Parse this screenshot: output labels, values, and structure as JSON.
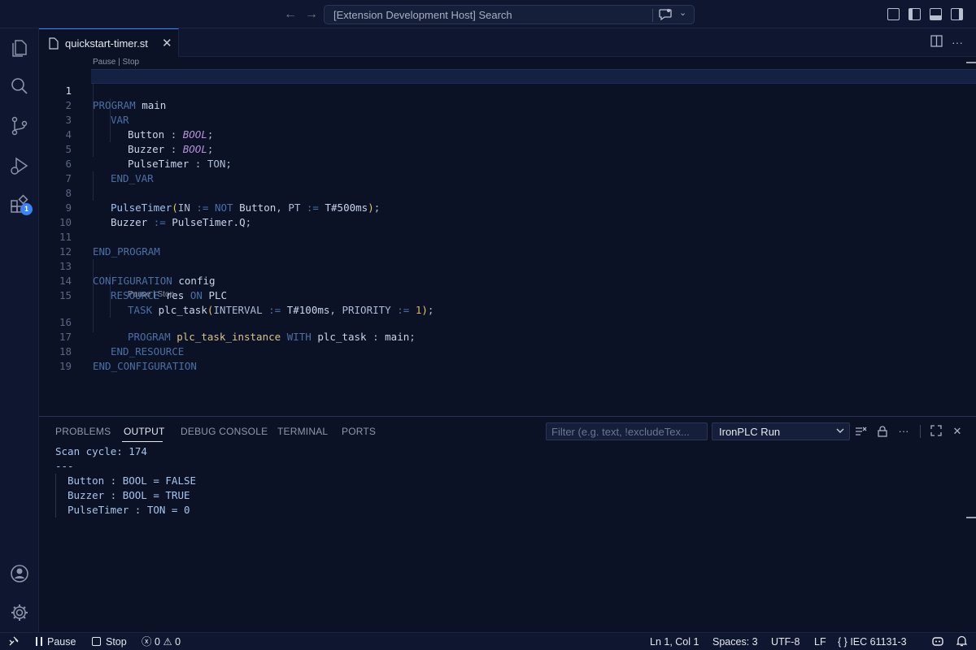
{
  "titlebar": {
    "search_text": "[Extension Development Host] Search",
    "back_icon": "arrow-left-icon",
    "forward_icon": "arrow-right-icon"
  },
  "activity_bar": {
    "items": [
      "explorer-icon",
      "search-icon",
      "source-control-icon",
      "run-debug-icon",
      "extensions-icon"
    ],
    "extensions_badge": "1",
    "bottom": [
      "account-icon",
      "settings-gear-icon"
    ]
  },
  "editor_tab": {
    "filename": "quickstart-timer.st",
    "close": "✕"
  },
  "editor": {
    "codelens_1": "Pause | Stop",
    "codelens_2": "Pause | Stop",
    "line_numbers": [
      "1",
      "2",
      "3",
      "4",
      "5",
      "6",
      "7",
      "8",
      "9",
      "10",
      "11",
      "12",
      "13",
      "14",
      "15",
      "16",
      "17",
      "18",
      "19"
    ],
    "lines": [
      "PROGRAM main",
      "  VAR",
      "    Button : BOOL;",
      "    Buzzer : BOOL;",
      "    PulseTimer : TON;",
      "  END_VAR",
      "",
      "  PulseTimer(IN := NOT Button, PT := T#500ms);",
      "  Buzzer := PulseTimer.Q;",
      "",
      "END_PROGRAM",
      "",
      "CONFIGURATION config",
      "  RESOURCE res ON PLC",
      "    TASK plc_task(INTERVAL := T#100ms, PRIORITY := 1);",
      "    PROGRAM plc_task_instance WITH plc_task : main;",
      "  END_RESOURCE",
      "END_CONFIGURATION",
      ""
    ]
  },
  "panel": {
    "tabs": [
      "PROBLEMS",
      "OUTPUT",
      "DEBUG CONSOLE",
      "TERMINAL",
      "PORTS"
    ],
    "active_tab": "OUTPUT",
    "filter_placeholder": "Filter (e.g. text, !excludeTex...",
    "channel": "IronPLC Run",
    "output_lines": [
      "Scan cycle: 174",
      "---",
      "Button : BOOL = FALSE",
      "Buzzer : BOOL = TRUE",
      "PulseTimer : TON = 0"
    ]
  },
  "statusbar": {
    "pause": "Pause",
    "stop": "Stop",
    "errors": "0",
    "warnings": "0",
    "position": "Ln 1, Col 1",
    "spaces": "Spaces: 3",
    "encoding": "UTF-8",
    "eol": "LF",
    "language": "IEC 61131-3"
  },
  "colors": {
    "background": "#0b1226",
    "chrome": "#0e1630",
    "accent": "#3b82f6",
    "keyword": "#4c6fa3",
    "type": "#b694d8"
  }
}
